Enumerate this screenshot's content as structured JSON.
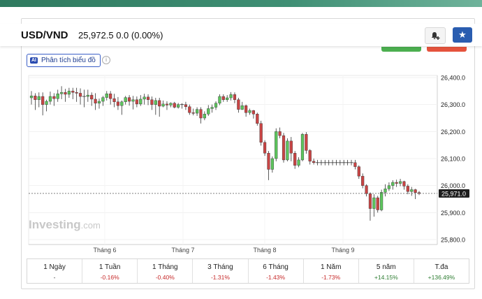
{
  "header": {
    "title": "USD/VND",
    "price": "25,972.5  0.0  (0.00%)"
  },
  "analysis_button": {
    "label": "Phân tích biểu đồ",
    "badge": "AI"
  },
  "watermark": {
    "main": "Investing",
    "suffix": ".com"
  },
  "chart_data": {
    "type": "candlestick",
    "y_ticks": [
      "26,400.0",
      "26,300.0",
      "26,200.0",
      "26,100.0",
      "26,000.0",
      "25,900.0",
      "25,800.0"
    ],
    "y_tick_values": [
      26400,
      26300,
      26200,
      26100,
      26000,
      25900,
      25800
    ],
    "ylim": [
      25800,
      26400
    ],
    "x_labels": [
      "Tháng 6",
      "Tháng 7",
      "Tháng 8",
      "Tháng 9"
    ],
    "current_price_label": "25,971.0",
    "current_price": 25971,
    "candles": [
      [
        26325,
        26332,
        26350,
        26300
      ],
      [
        26332,
        26318,
        26342,
        26280
      ],
      [
        26318,
        26330,
        26345,
        26290
      ],
      [
        26330,
        26300,
        26345,
        26260
      ],
      [
        26300,
        26312,
        26318,
        26275
      ],
      [
        26312,
        26330,
        26348,
        26300
      ],
      [
        26330,
        26322,
        26342,
        26295
      ],
      [
        26322,
        26340,
        26355,
        26310
      ],
      [
        26340,
        26345,
        26368,
        26320
      ],
      [
        26345,
        26338,
        26358,
        26310
      ],
      [
        26338,
        26350,
        26362,
        26325
      ],
      [
        26350,
        26345,
        26362,
        26320
      ],
      [
        26345,
        26342,
        26362,
        26310
      ],
      [
        26342,
        26330,
        26360,
        26300
      ],
      [
        26330,
        26330,
        26355,
        26290
      ],
      [
        26330,
        26335,
        26355,
        26310
      ],
      [
        26335,
        26320,
        26345,
        26295
      ],
      [
        26320,
        26305,
        26342,
        26280
      ],
      [
        26305,
        26312,
        26322,
        26285
      ],
      [
        26312,
        26326,
        26332,
        26295
      ],
      [
        26326,
        26340,
        26350,
        26315
      ],
      [
        26340,
        26322,
        26350,
        26300
      ],
      [
        26322,
        26310,
        26340,
        26290
      ],
      [
        26310,
        26296,
        26328,
        26280
      ],
      [
        26296,
        26310,
        26315,
        26262
      ],
      [
        26310,
        26326,
        26332,
        26300
      ],
      [
        26326,
        26312,
        26335,
        26296
      ],
      [
        26312,
        26318,
        26332,
        26282
      ],
      [
        26318,
        26302,
        26330,
        26290
      ],
      [
        26302,
        26320,
        26335,
        26295
      ],
      [
        26320,
        26328,
        26340,
        26300
      ],
      [
        26328,
        26318,
        26338,
        26298
      ],
      [
        26318,
        26300,
        26330,
        26280
      ],
      [
        26300,
        26315,
        26325,
        26262
      ],
      [
        26315,
        26294,
        26325,
        26255
      ],
      [
        26294,
        26302,
        26315,
        26290
      ],
      [
        26302,
        26298,
        26312,
        26280
      ],
      [
        26298,
        26305,
        26308,
        26290
      ],
      [
        26305,
        26290,
        26310,
        26286
      ],
      [
        26290,
        26300,
        26306,
        26285
      ],
      [
        26300,
        26300,
        26305,
        26285
      ],
      [
        26300,
        26292,
        26310,
        26280
      ],
      [
        26292,
        26270,
        26300,
        26262
      ],
      [
        26270,
        26268,
        26285,
        26260
      ],
      [
        26268,
        26282,
        26290,
        26258
      ],
      [
        26282,
        26250,
        26290,
        26230
      ],
      [
        26250,
        26265,
        26275,
        26242
      ],
      [
        26265,
        26285,
        26298,
        26258
      ],
      [
        26285,
        26290,
        26300,
        26270
      ],
      [
        26290,
        26305,
        26312,
        26280
      ],
      [
        26305,
        26330,
        26338,
        26298
      ],
      [
        26330,
        26318,
        26338,
        26310
      ],
      [
        26318,
        26325,
        26335,
        26310
      ],
      [
        26325,
        26337,
        26346,
        26315
      ],
      [
        26337,
        26318,
        26345,
        26305
      ],
      [
        26318,
        26282,
        26325,
        26270
      ],
      [
        26282,
        26296,
        26310,
        26280
      ],
      [
        26296,
        26270,
        26300,
        26255
      ],
      [
        26270,
        26278,
        26285,
        26262
      ],
      [
        26278,
        26265,
        26280,
        26248
      ],
      [
        26265,
        26230,
        26270,
        26222
      ],
      [
        26230,
        26160,
        26240,
        26148
      ],
      [
        26160,
        26120,
        26168,
        26110
      ],
      [
        26120,
        26060,
        26128,
        26020
      ],
      [
        26060,
        26100,
        26108,
        26048
      ],
      [
        26100,
        26200,
        26212,
        26090
      ],
      [
        26200,
        26185,
        26215,
        26175
      ],
      [
        26185,
        26095,
        26195,
        26085
      ],
      [
        26095,
        26165,
        26175,
        26090
      ],
      [
        26165,
        26120,
        26180,
        26090
      ],
      [
        26120,
        26075,
        26128,
        26062
      ],
      [
        26075,
        26095,
        26105,
        26068
      ],
      [
        26095,
        26190,
        26195,
        26090
      ],
      [
        26190,
        26130,
        26198,
        26118
      ],
      [
        26130,
        26090,
        26135,
        26078
      ],
      [
        26090,
        26085,
        26100,
        26078
      ],
      [
        26085,
        26085,
        26095,
        26075
      ],
      [
        26085,
        26085,
        26095,
        26075
      ],
      [
        26085,
        26085,
        26095,
        26075
      ],
      [
        26085,
        26085,
        26095,
        26075
      ],
      [
        26085,
        26085,
        26095,
        26075
      ],
      [
        26085,
        26085,
        26095,
        26075
      ],
      [
        26085,
        26085,
        26095,
        26075
      ],
      [
        26085,
        26085,
        26095,
        26075
      ],
      [
        26085,
        26085,
        26095,
        26075
      ],
      [
        26085,
        26085,
        26095,
        26075
      ],
      [
        26085,
        26070,
        26095,
        26060
      ],
      [
        26070,
        26035,
        26075,
        26025
      ],
      [
        26035,
        26000,
        26045,
        25990
      ],
      [
        26000,
        25970,
        26005,
        25960
      ],
      [
        25970,
        25915,
        25975,
        25870
      ],
      [
        25915,
        25955,
        25968,
        25885
      ],
      [
        25955,
        25910,
        25962,
        25900
      ],
      [
        25910,
        25975,
        25985,
        25905
      ],
      [
        25975,
        25988,
        26005,
        25960
      ],
      [
        25988,
        26000,
        26012,
        25980
      ],
      [
        26000,
        26012,
        26020,
        25985
      ],
      [
        26012,
        26008,
        26022,
        25995
      ],
      [
        26008,
        26015,
        26025,
        25998
      ],
      [
        26015,
        25998,
        26018,
        25985
      ],
      [
        25998,
        25978,
        26005,
        25968
      ],
      [
        25978,
        25985,
        25995,
        25962
      ],
      [
        25985,
        25974,
        25988,
        25950
      ],
      [
        25974,
        25971,
        25980,
        25965
      ]
    ]
  },
  "periods": [
    {
      "label": "1 Ngày",
      "value": "-",
      "tone": "neu"
    },
    {
      "label": "1 Tuần",
      "value": "-0.16%",
      "tone": "neg"
    },
    {
      "label": "1 Tháng",
      "value": "-0.40%",
      "tone": "neg"
    },
    {
      "label": "3 Tháng",
      "value": "-1.31%",
      "tone": "neg"
    },
    {
      "label": "6 Tháng",
      "value": "-1.43%",
      "tone": "neg"
    },
    {
      "label": "1 Năm",
      "value": "-1.73%",
      "tone": "neg"
    },
    {
      "label": "5 năm",
      "value": "+14.15%",
      "tone": "pos"
    },
    {
      "label": "T.đa",
      "value": "+136.49%",
      "tone": "pos"
    }
  ],
  "colors": {
    "up": "#5cc55c",
    "down": "#c94444",
    "wick": "#333333",
    "accent": "#2a5db0"
  }
}
